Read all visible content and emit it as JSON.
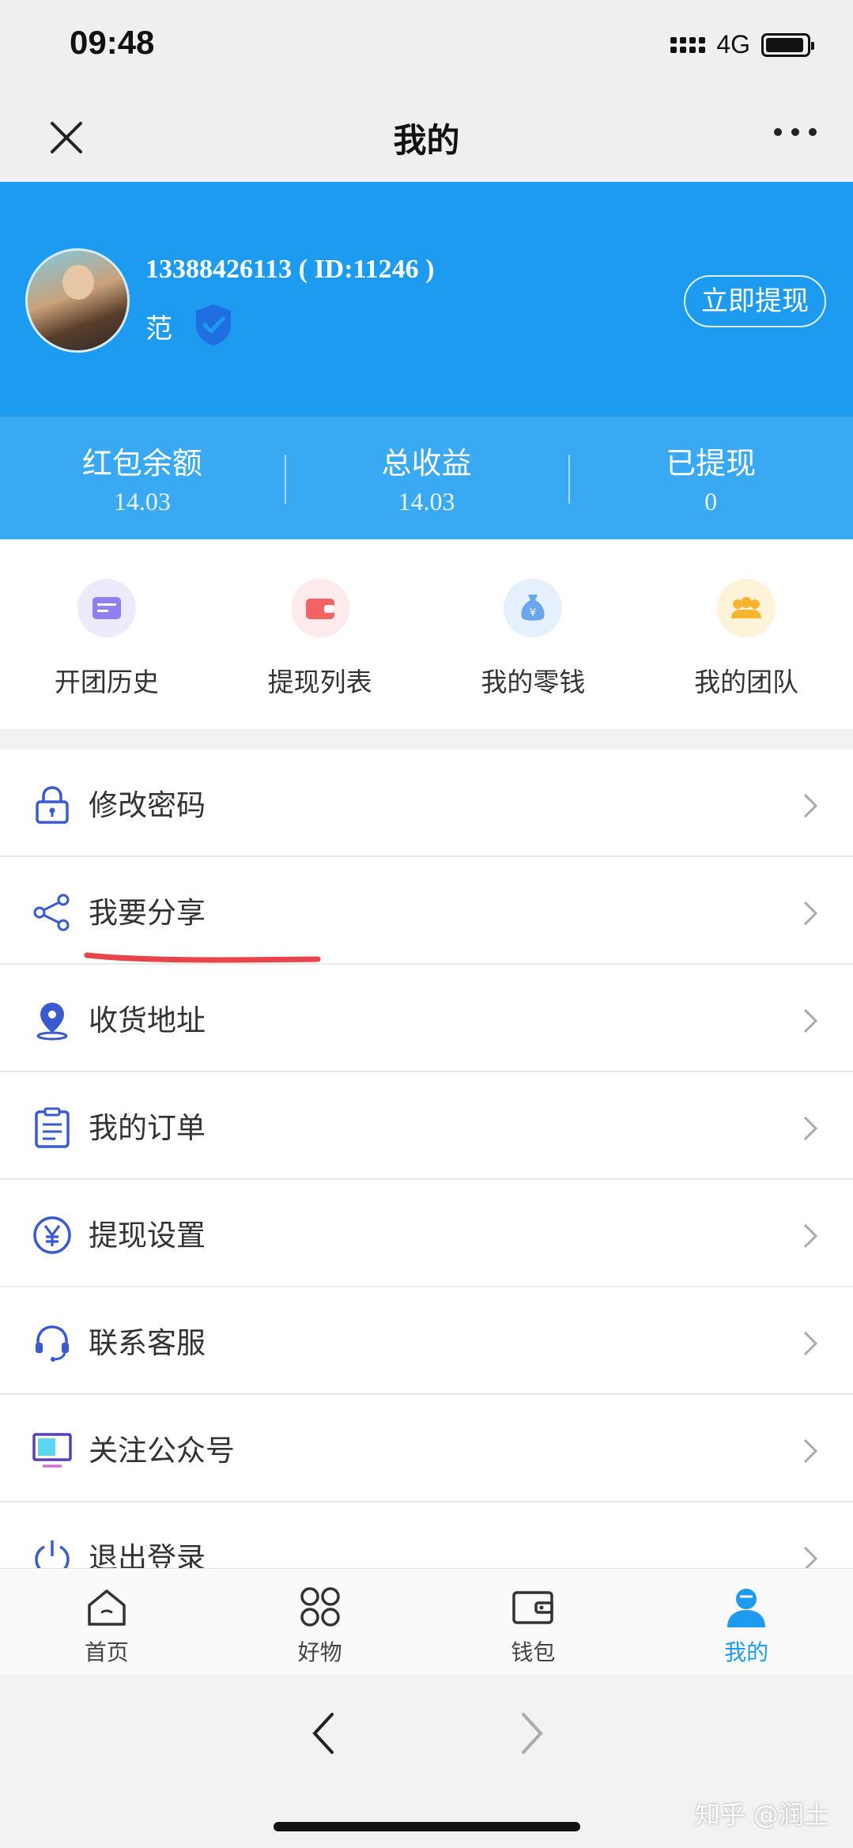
{
  "status_bar": {
    "time": "09:48",
    "network": "4G"
  },
  "nav": {
    "title": "我的"
  },
  "profile": {
    "phone_id": "13388426113 ( ID:11246 )",
    "name": "范",
    "withdraw_button": "立即提现"
  },
  "stats": [
    {
      "label": "红包余额",
      "value": "14.03"
    },
    {
      "label": "总收益",
      "value": "14.03"
    },
    {
      "label": "已提现",
      "value": "0"
    }
  ],
  "quick_actions": [
    {
      "label": "开团历史",
      "icon": "card-icon",
      "bg": "#ecebfb",
      "color": "#8f7ff0"
    },
    {
      "label": "提现列表",
      "icon": "wallet-icon",
      "bg": "#fdeaea",
      "color": "#f26464"
    },
    {
      "label": "我的零钱",
      "icon": "money-bag-icon",
      "bg": "#e5f0fc",
      "color": "#6aa6ec"
    },
    {
      "label": "我的团队",
      "icon": "team-icon",
      "bg": "#fdf3d8",
      "color": "#f6b52c"
    }
  ],
  "menu": [
    {
      "label": "修改密码",
      "icon": "lock-icon"
    },
    {
      "label": "我要分享",
      "icon": "share-icon"
    },
    {
      "label": "收货地址",
      "icon": "location-icon"
    },
    {
      "label": "我的订单",
      "icon": "order-icon"
    },
    {
      "label": "提现设置",
      "icon": "yuan-icon"
    },
    {
      "label": "联系客服",
      "icon": "headset-icon"
    },
    {
      "label": "关注公众号",
      "icon": "monitor-icon"
    },
    {
      "label": "退出登录",
      "icon": "power-icon"
    }
  ],
  "tabs": [
    {
      "label": "首页",
      "icon": "home-icon"
    },
    {
      "label": "好物",
      "icon": "grid-icon"
    },
    {
      "label": "钱包",
      "icon": "wallet-icon"
    },
    {
      "label": "我的",
      "icon": "user-icon"
    }
  ],
  "watermark": "知乎 @润土",
  "colors": {
    "primary": "#1d9bf0",
    "stats_bg": "#3aa9f3",
    "underline": "#e8454a",
    "icon_blue": "#3a5bd0"
  }
}
